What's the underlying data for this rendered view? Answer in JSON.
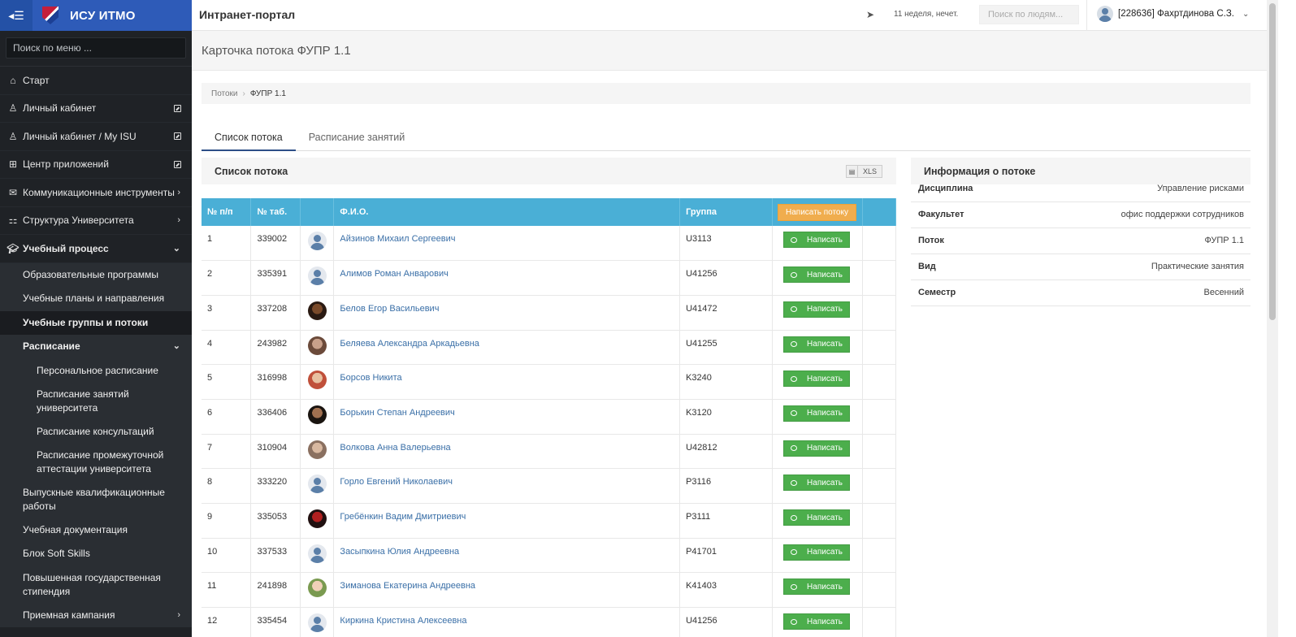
{
  "app": {
    "title": "ИСУ ИТМО",
    "portal": "Интранет-портал"
  },
  "sidebar": {
    "search_placeholder": "Поиск по меню ...",
    "items": [
      {
        "label": "Старт",
        "icon": "home-icon"
      },
      {
        "label": "Личный кабинет",
        "icon": "user-icon"
      },
      {
        "label": "Личный кабинет / My ISU",
        "icon": "user-icon"
      },
      {
        "label": "Центр приложений",
        "icon": "grid-icon"
      },
      {
        "label": "Коммуникационные инструменты",
        "icon": "chat-icon"
      },
      {
        "label": "Структура Университета",
        "icon": "sitemap-icon"
      },
      {
        "label": "Учебный процесс",
        "icon": "graduation-cap-icon"
      }
    ],
    "sub": [
      "Образовательные программы",
      "Учебные планы и направления",
      "Учебные группы и потоки",
      "Расписание"
    ],
    "schedule_sub": [
      "Персональное расписание",
      "Расписание занятий университета",
      "Расписание консультаций",
      "Расписание промежуточной аттестации университета"
    ],
    "more": [
      "Выпускные квалификационные работы",
      "Учебная документация",
      "Блок Soft Skills",
      "Повышенная государственная стипендия",
      "Приемная кампания"
    ]
  },
  "header": {
    "week": "11 неделя, нечет.",
    "people_search_placeholder": "Поиск по людям...",
    "user": "[228636] Фахртдинова С.З."
  },
  "page": {
    "title": "Карточка потока ФУПР 1.1",
    "breadcrumb": [
      "Потоки",
      "ФУПР 1.1"
    ],
    "tabs": [
      "Список потока",
      "Расписание занятий"
    ]
  },
  "list": {
    "title": "Список потока",
    "xls": "XLS",
    "columns": [
      "№ п/п",
      "№ таб.",
      "",
      "Ф.И.О.",
      "Группа"
    ],
    "write_all": "Написать потоку",
    "write": "Написать",
    "rows": [
      {
        "n": "1",
        "tab": "339002",
        "name": "Айзинов Михаил Сергеевич",
        "group": "U3113",
        "photo": "default"
      },
      {
        "n": "2",
        "tab": "335391",
        "name": "Алимов Роман Анварович",
        "group": "U41256",
        "photo": "default"
      },
      {
        "n": "3",
        "tab": "337208",
        "name": "Белов Егор Васильевич",
        "group": "U41472",
        "photo": "#7a4a2a|#2a1a12"
      },
      {
        "n": "4",
        "tab": "243982",
        "name": "Беляева Александра Аркадьевна",
        "group": "U41255",
        "photo": "#c8a08a|#6b4a3a"
      },
      {
        "n": "5",
        "tab": "316998",
        "name": "Борсов Никита",
        "group": "K3240",
        "photo": "#e8c0a0|#c0503a"
      },
      {
        "n": "6",
        "tab": "336406",
        "name": "Борькин Степан Андреевич",
        "group": "K3120",
        "photo": "#a07050|#1a1410"
      },
      {
        "n": "7",
        "tab": "310904",
        "name": "Волкова Анна Валерьевна",
        "group": "U42812",
        "photo": "#d8b8a0|#8a7060"
      },
      {
        "n": "8",
        "tab": "333220",
        "name": "Горло Евгений Николаевич",
        "group": "P3116",
        "photo": "default"
      },
      {
        "n": "9",
        "tab": "335053",
        "name": "Гребёнкин Вадим Дмитриевич",
        "group": "P3111",
        "photo": "#b02020|#201010"
      },
      {
        "n": "10",
        "tab": "337533",
        "name": "Засыпкина Юлия Андреевна",
        "group": "P41701",
        "photo": "default"
      },
      {
        "n": "11",
        "tab": "241898",
        "name": "Зиманова Екатерина Андреевна",
        "group": "K41403",
        "photo": "#f0d0b8|#7a9a50"
      },
      {
        "n": "12",
        "tab": "335454",
        "name": "Киркина Кристина Алексеевна",
        "group": "U41256",
        "photo": "default"
      }
    ]
  },
  "info": {
    "title": "Информация о потоке",
    "rows": [
      {
        "k": "Дисциплина",
        "v": "Управление рисками"
      },
      {
        "k": "Факультет",
        "v": "офис поддержки сотрудников"
      },
      {
        "k": "Поток",
        "v": "ФУПР 1.1"
      },
      {
        "k": "Вид",
        "v": "Практические занятия"
      },
      {
        "k": "Семестр",
        "v": "Весенний"
      }
    ]
  },
  "colors": {
    "brand": "#2e5bb8",
    "sidebar": "#1f2226",
    "table_header": "#4aafd6",
    "write": "#4cae4c",
    "write_all": "#f0ad4e"
  }
}
